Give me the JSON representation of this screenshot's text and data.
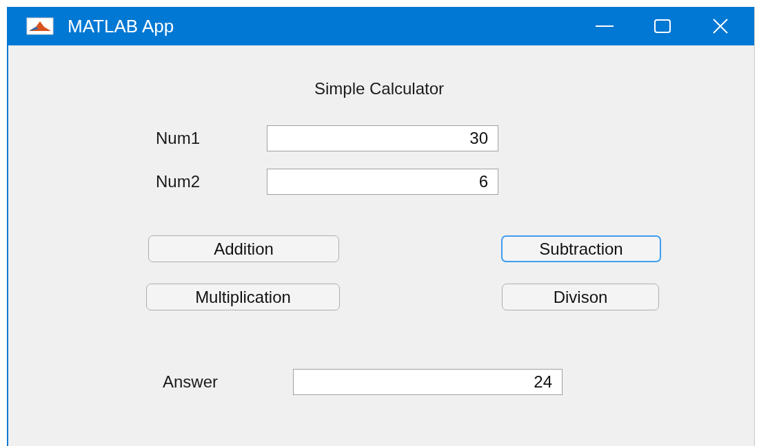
{
  "window": {
    "title": "MATLAB App"
  },
  "heading": "Simple Calculator",
  "inputs": [
    {
      "label": "Num1",
      "value": "30"
    },
    {
      "label": "Num2",
      "value": "6"
    }
  ],
  "buttons": [
    {
      "label": "Addition",
      "focused": false
    },
    {
      "label": "Subtraction",
      "focused": true
    },
    {
      "label": "Multiplication",
      "focused": false
    },
    {
      "label": "Divison",
      "focused": false
    }
  ],
  "answer": {
    "label": "Answer",
    "value": "24"
  }
}
